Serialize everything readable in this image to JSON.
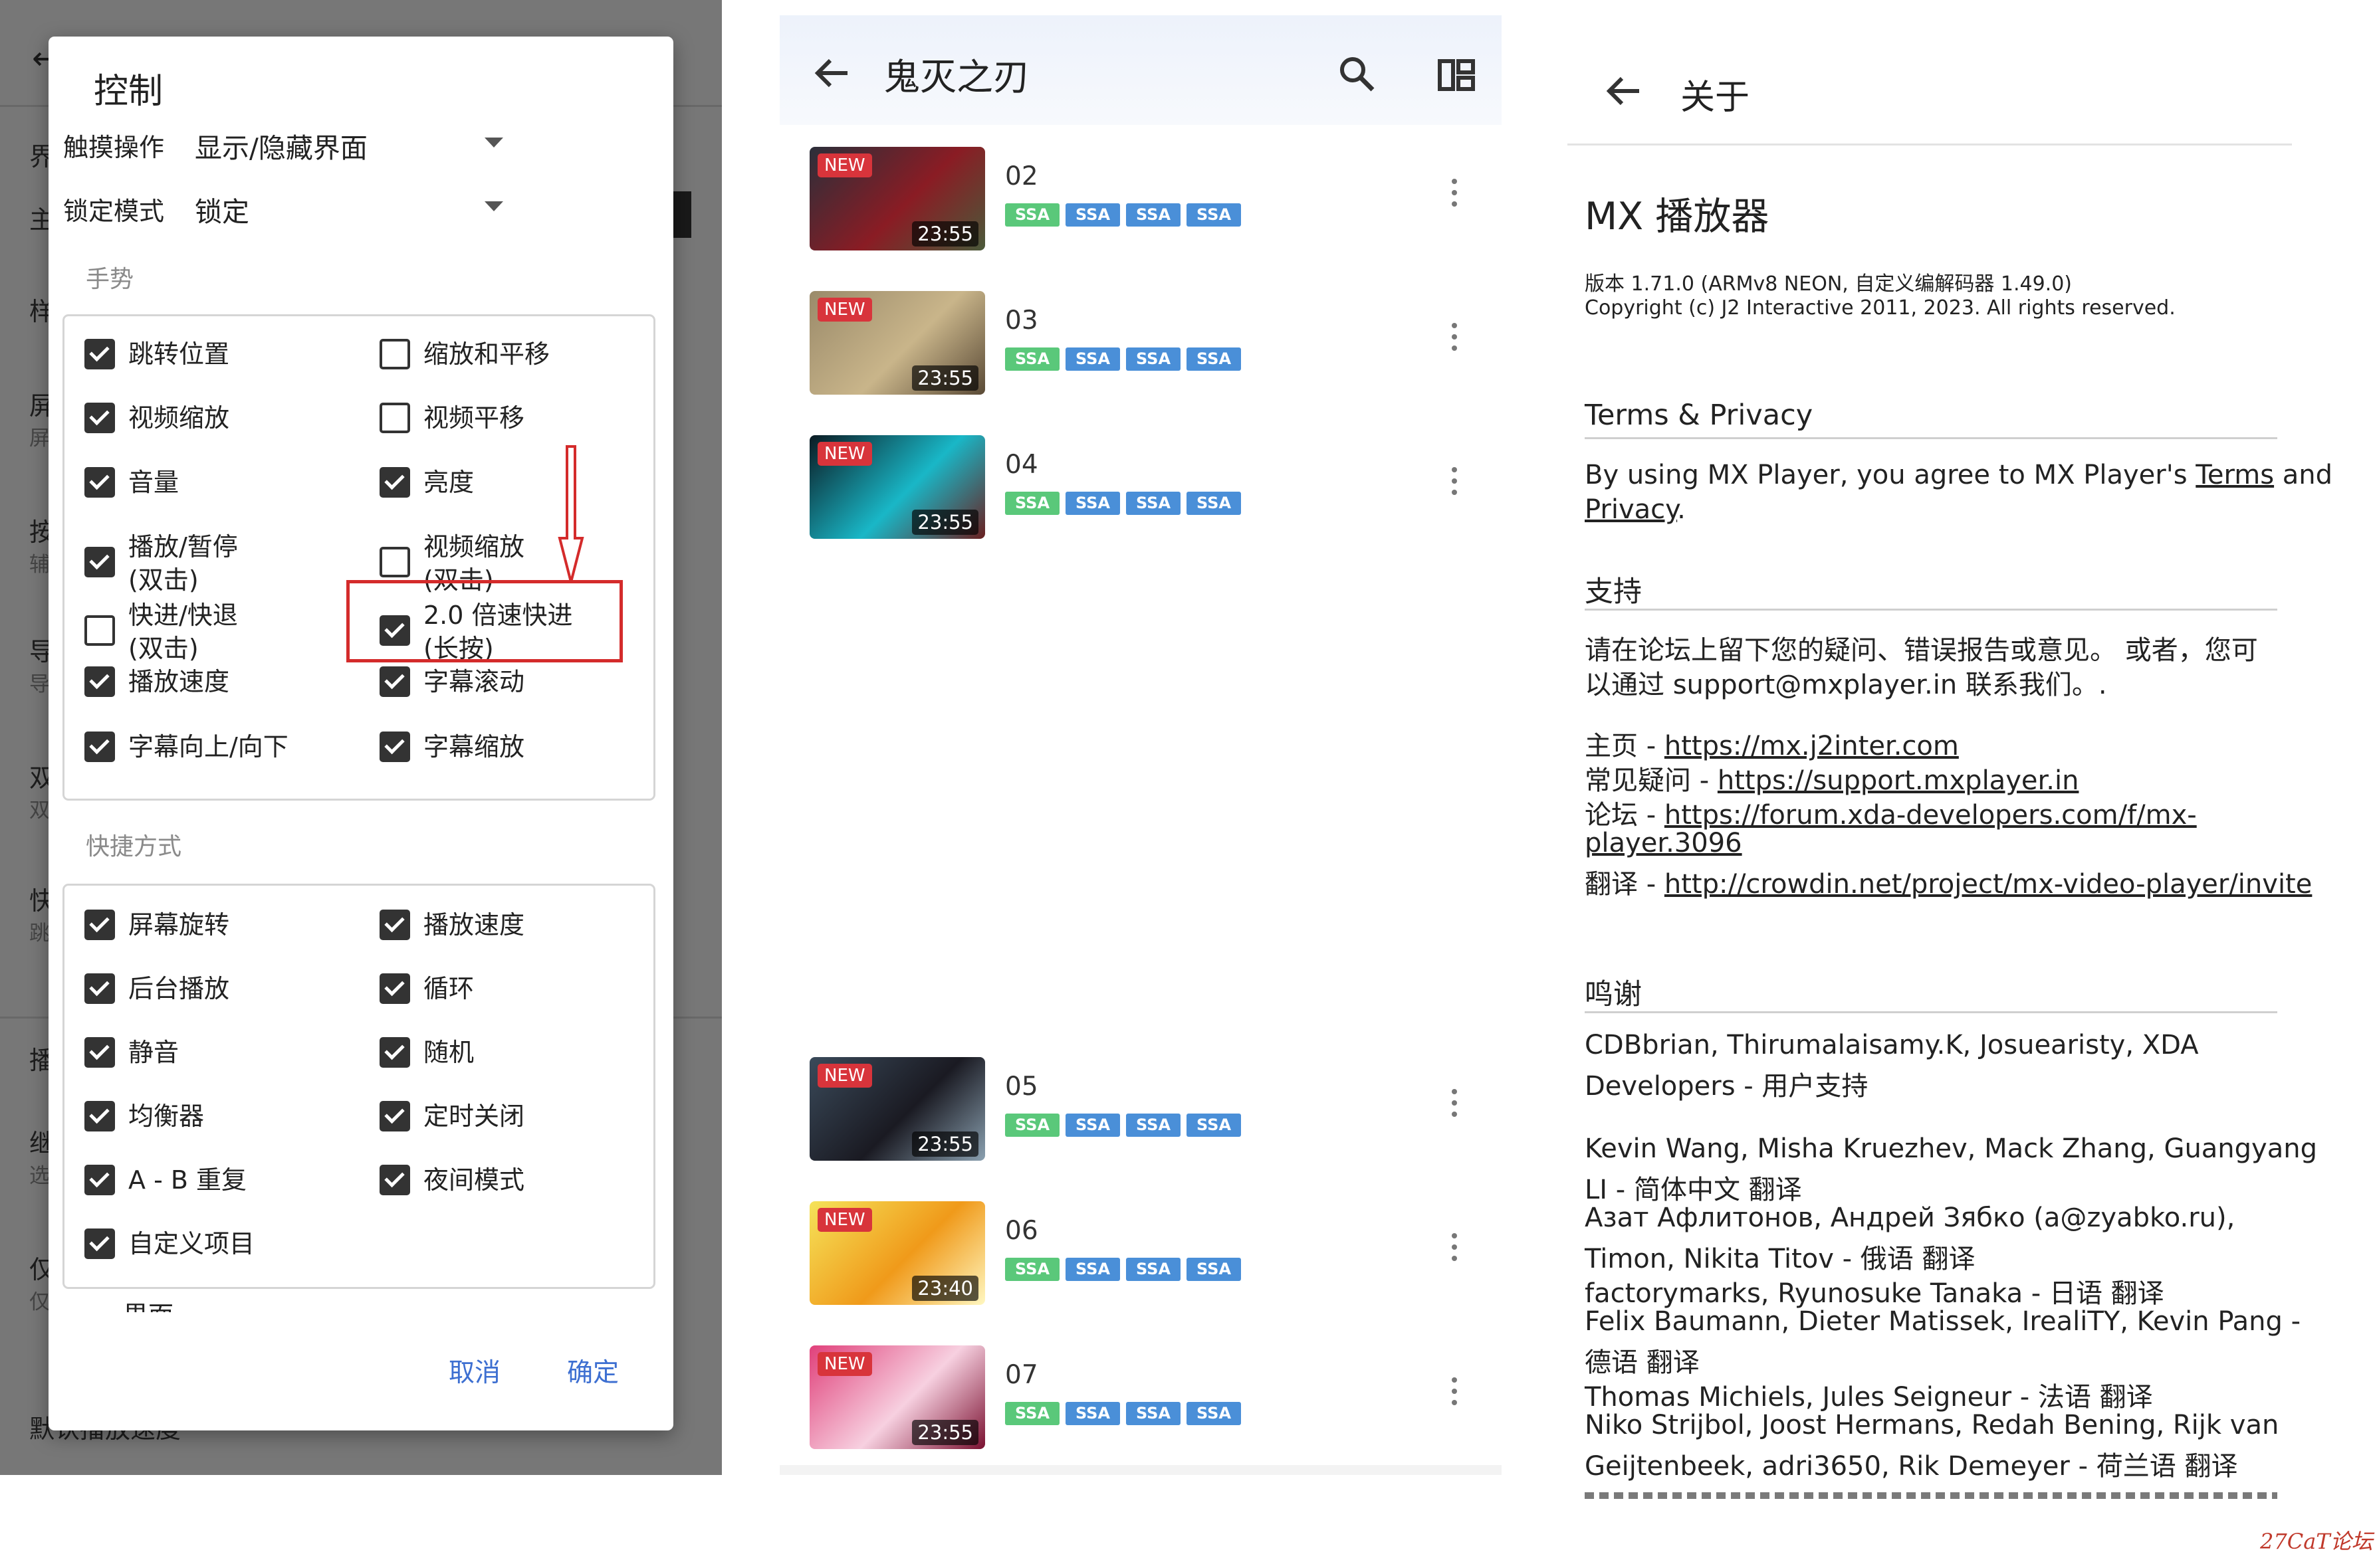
{
  "left": {
    "background_items": [
      {
        "text": "界",
        "sub": ""
      },
      {
        "text": "主",
        "sub": ""
      },
      {
        "text": "样",
        "sub": ""
      },
      {
        "text": "屏",
        "sub": "屏"
      },
      {
        "text": "按",
        "sub": "辅"
      },
      {
        "text": "导",
        "sub": "导"
      },
      {
        "text": "双",
        "sub": "双"
      },
      {
        "text": "快",
        "sub": "跳"
      },
      {
        "text": "播",
        "sub": ""
      },
      {
        "text": "继",
        "sub": "选"
      },
      {
        "text": "仅",
        "sub": "仅"
      },
      {
        "text": "默认播放速度",
        "sub": ""
      }
    ],
    "dialog": {
      "title": "控制",
      "touch_label": "触摸操作",
      "touch_value": "显示/隐藏界面",
      "lock_label": "锁定模式",
      "lock_value": "锁定",
      "gestures_header": "手势",
      "gestures": [
        {
          "label": "跳转位置",
          "checked": true
        },
        {
          "label": "缩放和平移",
          "checked": false
        },
        {
          "label": "视频缩放",
          "checked": true
        },
        {
          "label": "视频平移",
          "checked": false
        },
        {
          "label": "音量",
          "checked": true
        },
        {
          "label": "亮度",
          "checked": true
        },
        {
          "label": "播放/暂停",
          "label2": "(双击)",
          "checked": true
        },
        {
          "label": "视频缩放",
          "label2": "(双击)",
          "checked": false
        },
        {
          "label": "快进/快退",
          "label2": "(双击)",
          "checked": false
        },
        {
          "label": "2.0 倍速快进",
          "label2": "(长按)",
          "checked": true,
          "highlighted": true
        },
        {
          "label": "播放速度",
          "checked": true
        },
        {
          "label": "字幕滚动",
          "checked": true
        },
        {
          "label": "字幕向上/向下",
          "checked": true
        },
        {
          "label": "字幕缩放",
          "checked": true
        }
      ],
      "shortcuts_header": "快捷方式",
      "shortcuts": [
        {
          "label": "屏幕旋转",
          "checked": true
        },
        {
          "label": "播放速度",
          "checked": true
        },
        {
          "label": "后台播放",
          "checked": true
        },
        {
          "label": "循环",
          "checked": true
        },
        {
          "label": "静音",
          "checked": true
        },
        {
          "label": "随机",
          "checked": true
        },
        {
          "label": "均衡器",
          "checked": true
        },
        {
          "label": "定时关闭",
          "checked": true
        },
        {
          "label": "A - B 重复",
          "checked": true
        },
        {
          "label": "夜间模式",
          "checked": true
        },
        {
          "label": "自定义项目",
          "checked": true
        }
      ],
      "cut_text": "界面",
      "cancel": "取消",
      "confirm": "确定"
    }
  },
  "middle": {
    "title": "鬼灭之刃",
    "back_icon": "arrow-left-icon",
    "search_icon": "search-icon",
    "view_icon": "layout-grid-icon",
    "episodes": [
      {
        "num": "02",
        "duration": "23:55",
        "thumb_colors": [
          "#2b2f3a",
          "#8a1c24",
          "#4a5a3a"
        ]
      },
      {
        "num": "03",
        "duration": "23:55",
        "thumb_colors": [
          "#9a8a6a",
          "#c9b58a",
          "#5a4a36"
        ]
      },
      {
        "num": "04",
        "duration": "23:55",
        "thumb_colors": [
          "#0b1a22",
          "#19b7c7",
          "#6a1f1f"
        ]
      },
      {
        "num": "05",
        "duration": "23:55",
        "thumb_colors": [
          "#3a4a5a",
          "#1a1a22",
          "#8aa0b0"
        ]
      },
      {
        "num": "06",
        "duration": "23:40",
        "thumb_colors": [
          "#f5e35a",
          "#f09a1a",
          "#fff7c0"
        ]
      },
      {
        "num": "07",
        "duration": "23:55",
        "thumb_colors": [
          "#e0407a",
          "#f7d0e0",
          "#7a1030"
        ]
      }
    ],
    "new_label": "NEW",
    "badge_label": "SSA",
    "badge_colors": [
      "#5ac87a",
      "#4a8fd8",
      "#4a8fd8",
      "#4a8fd8"
    ]
  },
  "right": {
    "title": "关于",
    "app_name": "MX 播放器",
    "version": "版本 1.71.0 (ARMv8 NEON, 自定义编解码器 1.49.0)",
    "copyright": "Copyright (c) J2 Interactive 2011, 2023. All rights reserved.",
    "terms_header": "Terms & Privacy",
    "terms_pre": "By using MX Player, you agree to MX Player's ",
    "terms_link": "Terms",
    "terms_and": " and",
    "privacy_link": "Privacy",
    "privacy_dot": ".",
    "support_header": "支持",
    "support_line1": "请在论坛上留下您的疑问、错误报告或意见。 或者，您可",
    "support_line2": "以通过 support@mxplayer.in 联系我们。.",
    "home_label": "主页 - ",
    "home_url": "https://mx.j2inter.com",
    "faq_label": "常见疑问 - ",
    "faq_url": "https://support.mxplayer.in",
    "forum_label": "论坛 - ",
    "forum_url1": "https://forum.xda-developers.com/f/mx-",
    "forum_url2": "player.3096",
    "translate_label": "翻译 - ",
    "translate_url": "http://crowdin.net/project/mx-video-player/invite",
    "thanks_header": "鸣谢",
    "thanks_lines": [
      "CDBbrian, Thirumalaisamy.K, Josuearisty, XDA",
      "Developers - 用户支持",
      "",
      "Kevin Wang, Misha Kruezhev, Mack Zhang, Guangyang",
      "LI - 简体中文 翻译",
      "Азат Афлитонов, Андрей Зябко (a@zyabko.ru),",
      "Timon, Nikita Titov - 俄语 翻译",
      "factorymarks, Ryunosuke Tanaka - 日语 翻译",
      "Felix Baumann, Dieter Matissek, IrealiTY, Kevin Pang -",
      "德语 翻译",
      "Thomas Michiels, Jules Seigneur - 法语 翻译",
      "Niko Strijbol, Joost Hermans, Redah Bening, Rijk van",
      "Geijtenbeek, adri3650, Rik Demeyer - 荷兰语 翻译"
    ]
  },
  "watermark": "27CaT论坛"
}
